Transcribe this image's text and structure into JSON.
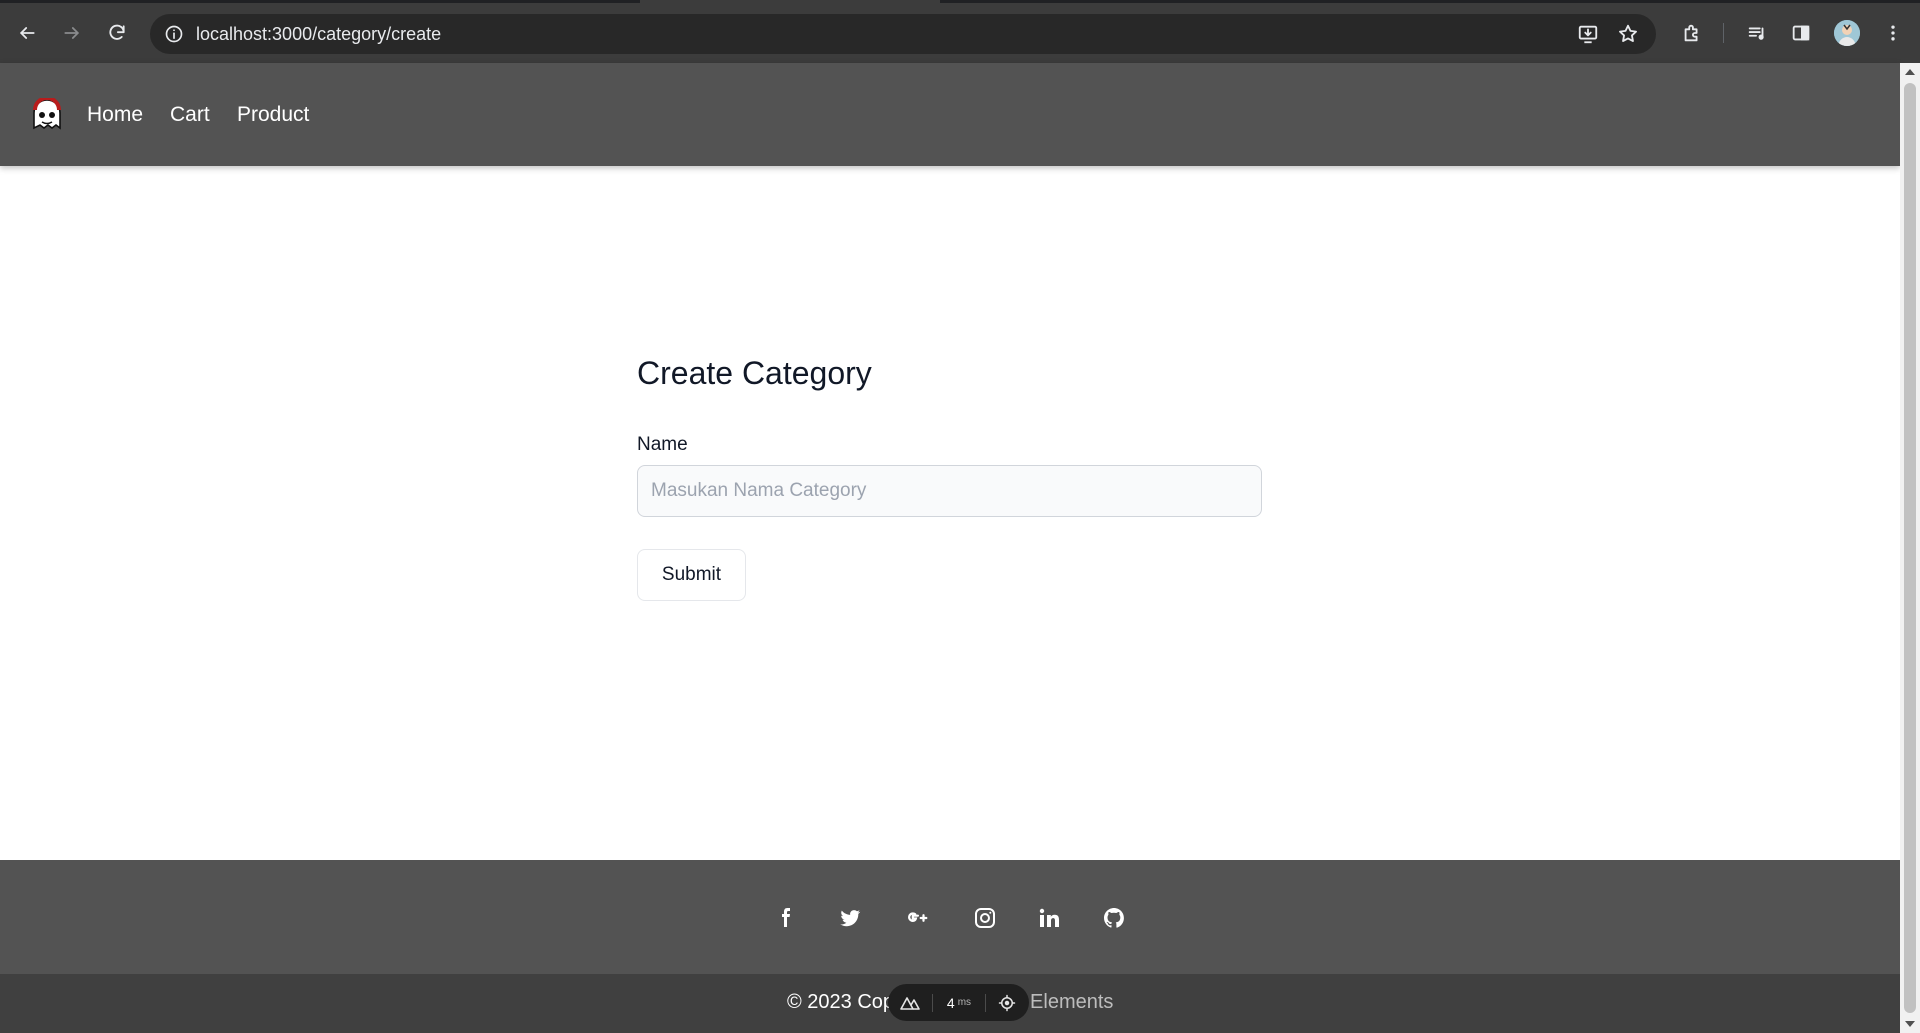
{
  "browser": {
    "url": "localhost:3000/category/create"
  },
  "navbar": {
    "links": [
      {
        "label": "Home"
      },
      {
        "label": "Cart"
      },
      {
        "label": "Product"
      }
    ]
  },
  "form": {
    "title": "Create Category",
    "name_label": "Name",
    "name_placeholder": "Masukan Nama Category",
    "name_value": "",
    "submit_label": "Submit"
  },
  "footer": {
    "social_icons": [
      "facebook-icon",
      "twitter-icon",
      "google-plus-icon",
      "instagram-icon",
      "linkedin-icon",
      "github-icon"
    ],
    "copyright_visible": "© 2023 Cop",
    "copyright_trailing": "Elements"
  },
  "dev_indicator": {
    "value": "4",
    "unit": "ms"
  },
  "colors": {
    "navbar_bg": "#535353",
    "footer_social_bg": "#535353",
    "footer_bottom_bg": "#404040",
    "browser_chrome_bg": "#3c3c3c"
  }
}
